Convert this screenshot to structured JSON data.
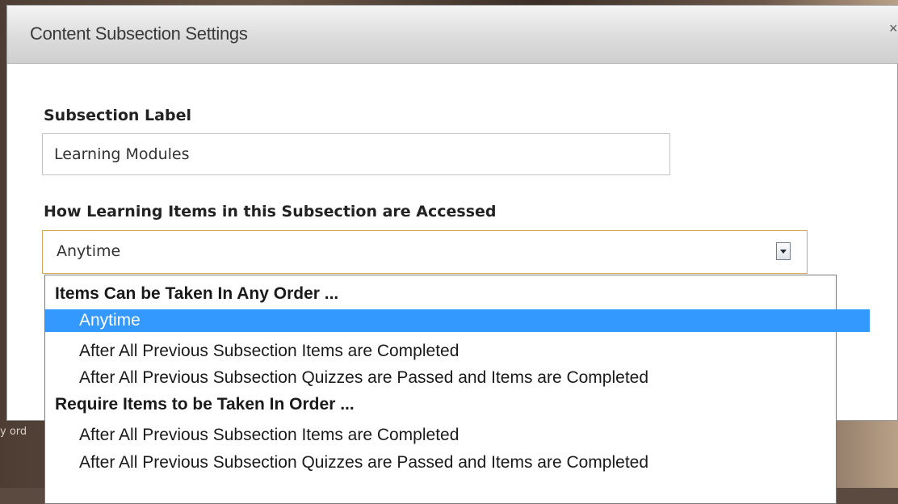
{
  "dialog": {
    "title": "Content Subsection Settings",
    "close_glyph": "×"
  },
  "backdrop_text": "y ord",
  "form": {
    "subsection_label": "Subsection Label",
    "subsection_value": "Learning Modules",
    "access_label": "How Learning Items in this Subsection are Accessed",
    "access_selected": "Anytime"
  },
  "dropdown": {
    "groups": [
      {
        "label": "Items Can be Taken In Any Order ...",
        "options": [
          "Anytime",
          "After All Previous Subsection Items are Completed",
          "After All Previous Subsection Quizzes are Passed and Items are Completed"
        ]
      },
      {
        "label": "Require Items to be Taken In Order ...",
        "options": [
          "After All Previous Subsection Items are Completed",
          "After All Previous Subsection Quizzes are Passed and Items are Completed"
        ]
      }
    ],
    "highlighted_option": "Anytime"
  },
  "colors": {
    "highlight": "#3399ff",
    "select_border": "#d4a85a"
  },
  "icons": {
    "close": "close-icon",
    "dropdown_arrow": "chevron-down-icon"
  }
}
